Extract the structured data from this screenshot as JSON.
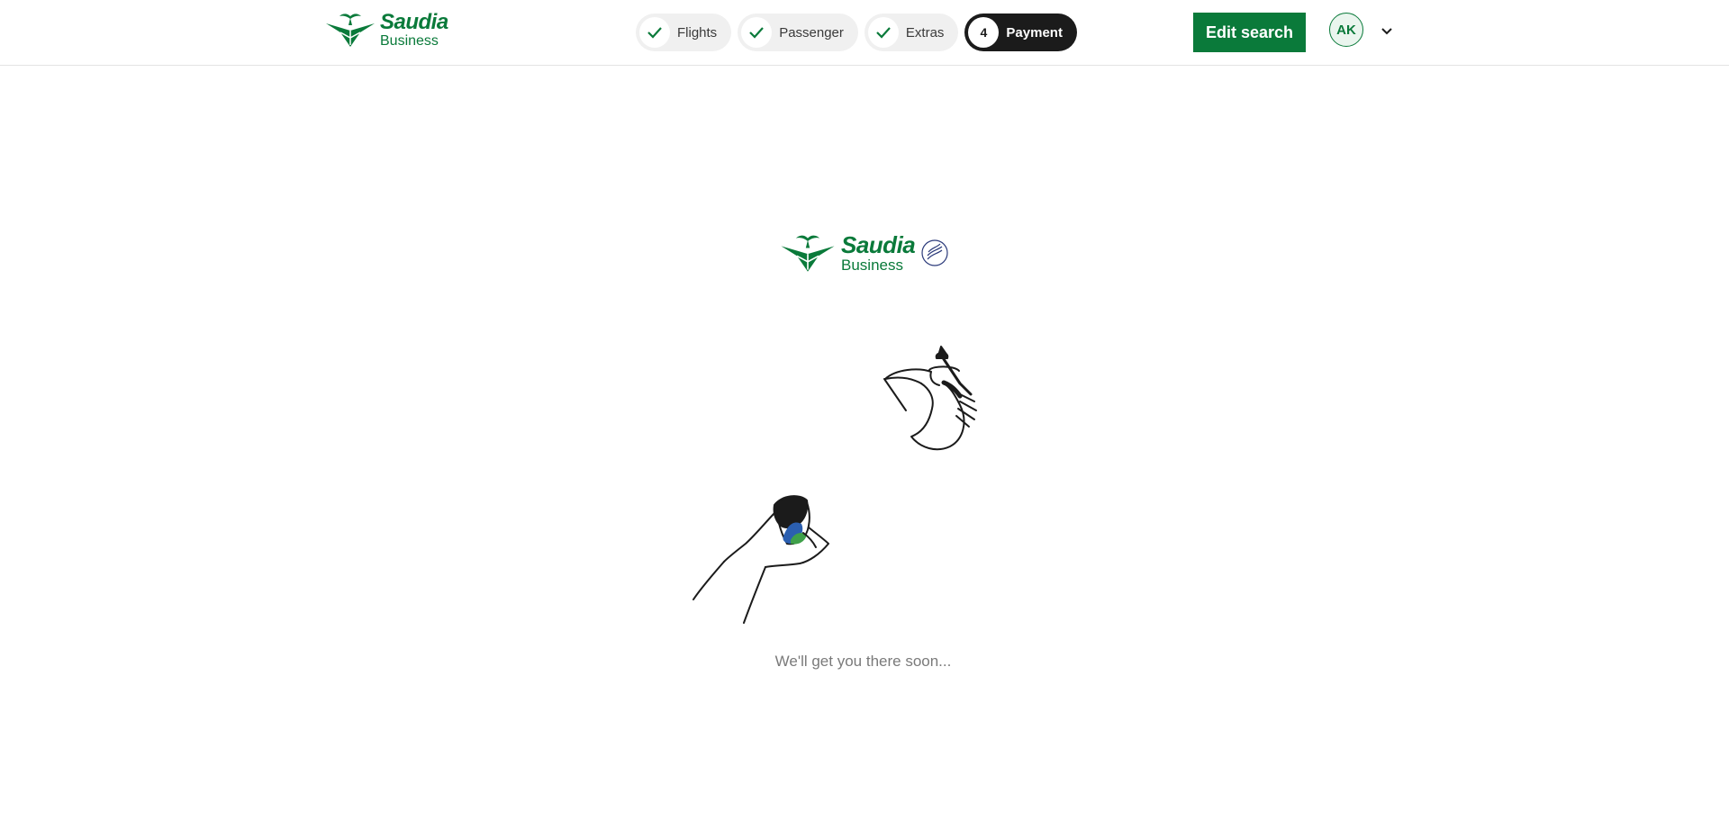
{
  "header": {
    "brand": {
      "name": "Saudia",
      "sub": "Business"
    },
    "steps": [
      {
        "label": "Flights",
        "state": "done",
        "icon": "check-icon"
      },
      {
        "label": "Passenger",
        "state": "done",
        "icon": "check-icon"
      },
      {
        "label": "Extras",
        "state": "done",
        "icon": "check-icon"
      },
      {
        "label": "Payment",
        "state": "active",
        "number": "4"
      }
    ],
    "edit_search_label": "Edit search",
    "user_initials": "AK",
    "menu_icon": "chevron-down-icon"
  },
  "loader": {
    "brand": {
      "name": "Saudia",
      "sub": "Business",
      "alliance_icon": "skyteam-icon"
    },
    "illustration": "coffee-pot-pouring-into-cup-illustration",
    "message": "We'll get you there soon..."
  },
  "colors": {
    "brand_green": "#0a7a3a",
    "active_step": "#1b1b1b",
    "step_bg": "#f0f0f0",
    "text_muted": "#7a7a7a"
  }
}
